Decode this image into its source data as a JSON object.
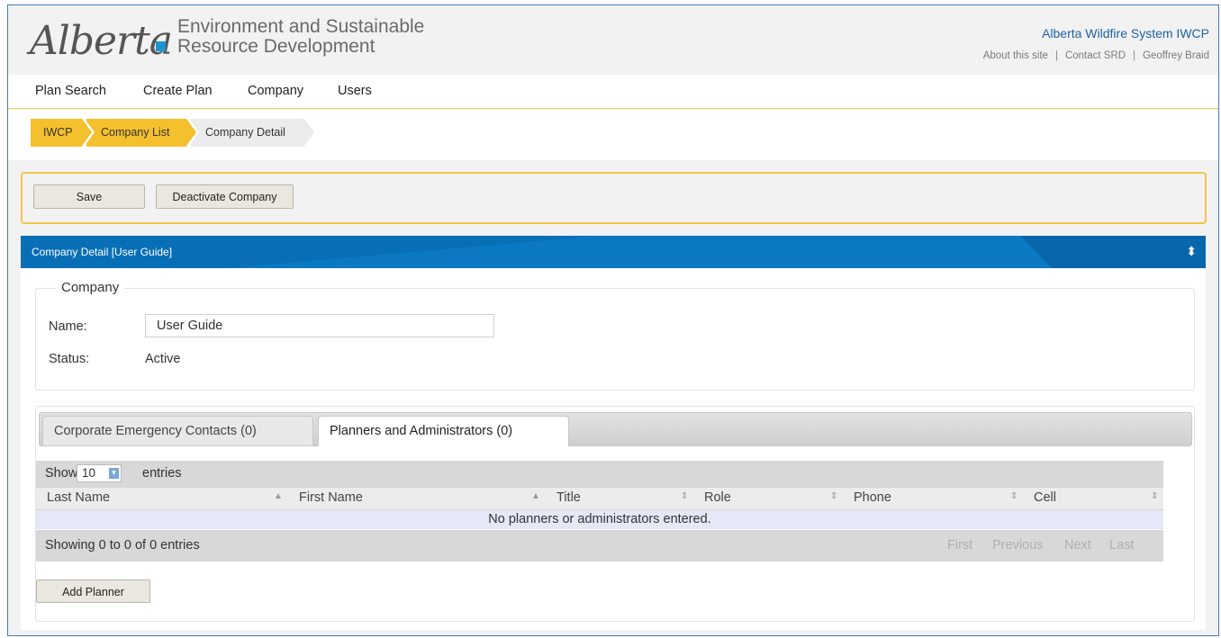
{
  "header": {
    "logo_text": "Alberta",
    "dept_line1": "Environment and Sustainable",
    "dept_line2": "Resource Development",
    "system_title": "Alberta Wildfire System IWCP",
    "links": [
      "About this site",
      "Contact SRD",
      "Geoffrey Braid"
    ],
    "link_separator": "|"
  },
  "nav": {
    "items": [
      "Plan Search",
      "Create Plan",
      "Company",
      "Users"
    ]
  },
  "breadcrumb": {
    "items": [
      "IWCP",
      "Company List",
      "Company Detail"
    ]
  },
  "actions": {
    "save_label": "Save",
    "deactivate_label": "Deactivate Company"
  },
  "panel": {
    "title": "Company Detail [User Guide]",
    "toggle_icon": "sort-toggle-icon"
  },
  "company": {
    "legend": "Company",
    "name_label": "Name:",
    "name_value": "User Guide",
    "status_label": "Status:",
    "status_value": "Active"
  },
  "tabs": {
    "items": [
      "Corporate Emergency Contacts (0)",
      "Planners and Administrators (0)"
    ],
    "active_index": 1
  },
  "table": {
    "show_label": "Show",
    "page_size": "10",
    "entries_label": "entries",
    "columns": [
      "Last Name",
      "First Name",
      "Title",
      "Role",
      "Phone",
      "Cell"
    ],
    "empty_message": "No planners or administrators entered.",
    "info": "Showing 0 to 0 of 0 entries",
    "pagination": [
      "First",
      "Previous",
      "Next",
      "Last"
    ]
  },
  "add_planner_label": "Add Planner",
  "colors": {
    "accent_yellow": "#f5c02e",
    "panel_blue": "#0a78c2",
    "link_blue": "#1a62a5",
    "empty_row": "#e5e8f7"
  }
}
